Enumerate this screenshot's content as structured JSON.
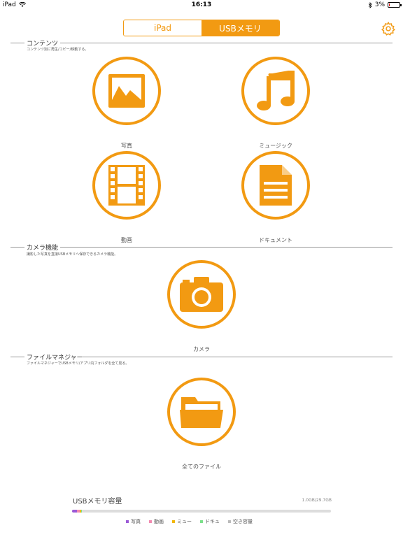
{
  "status_bar": {
    "device": "iPad",
    "time": "16:13",
    "battery": "3%"
  },
  "segmented": {
    "left_label": "iPad",
    "right_label": "USBメモリ",
    "selected": "USBメモリ"
  },
  "sections": {
    "contents": {
      "title": "コンテンツ",
      "desc": "コンテンツ別に再生/コピー/移動する。"
    },
    "camera": {
      "title": "カメラ機能",
      "desc": "撮影した写真を直接USBメモリへ保存できるカメラ機能。"
    },
    "files": {
      "title": "ファイルマネジャー",
      "desc": "ファイルマネジャーでUSBメモリ/アプリ内フォルダを全て見る。"
    }
  },
  "tiles": {
    "photo": {
      "label": "写真",
      "icon": "photo-icon"
    },
    "music": {
      "label": "ミュージック",
      "icon": "music-icon"
    },
    "video": {
      "label": "動画",
      "icon": "film-icon"
    },
    "document": {
      "label": "ドキュメント",
      "icon": "document-icon"
    },
    "camera": {
      "label": "カメラ",
      "icon": "camera-icon"
    },
    "files": {
      "label": "全てのファイル",
      "icon": "folder-icon"
    }
  },
  "storage": {
    "title": "USBメモリ容量",
    "amount": "1.0GB/29.7GB",
    "used_fractions": {
      "photo": 0.018,
      "video": 0.012,
      "music": 0.004,
      "document": 0.002
    },
    "legend": [
      {
        "label": "写真",
        "color": "#9b59d6"
      },
      {
        "label": "動画",
        "color": "#f28ab0"
      },
      {
        "label": "ミュー",
        "color": "#f2b705"
      },
      {
        "label": "ドキュ",
        "color": "#7be08a"
      },
      {
        "label": "空き容量",
        "color": "#bbbbbb"
      }
    ]
  },
  "colors": {
    "accent": "#f29a12"
  }
}
